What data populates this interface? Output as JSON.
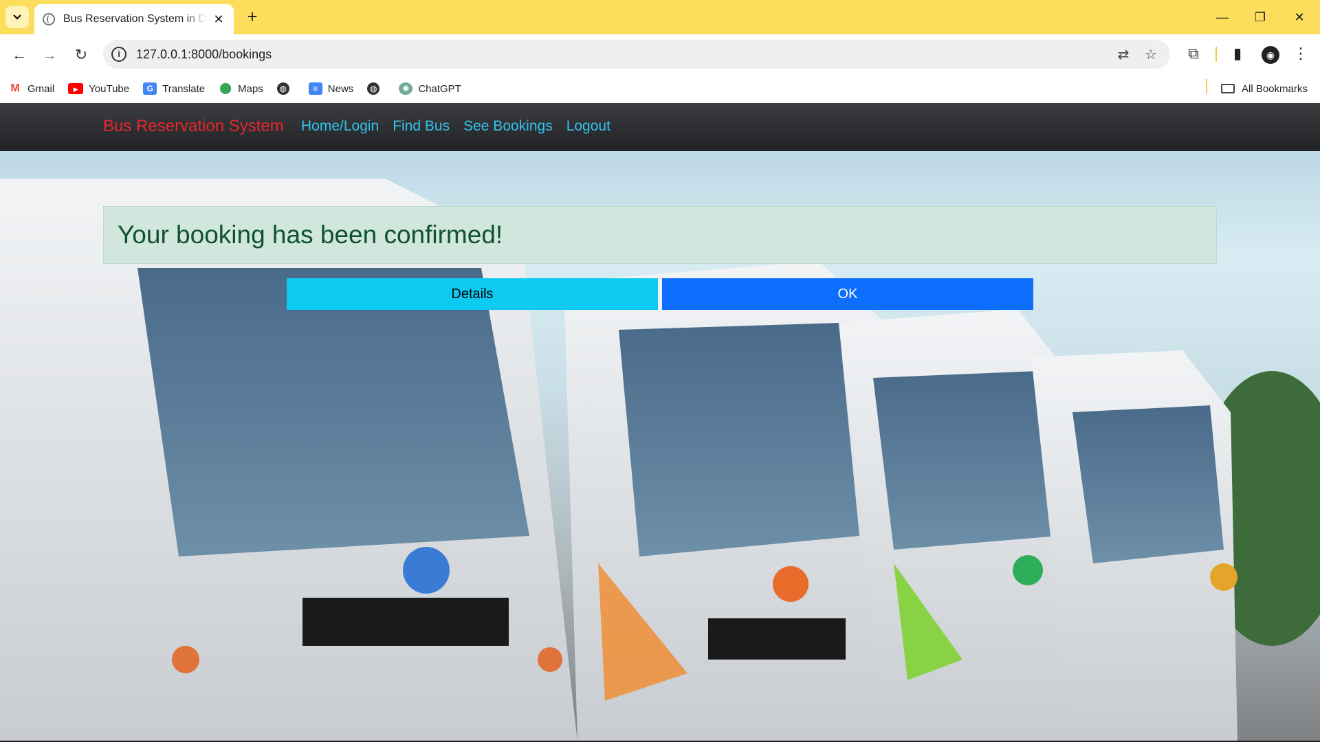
{
  "browser": {
    "tab_title": "Bus Reservation System in Djan",
    "url": "127.0.0.1:8000/bookings",
    "bookmarks": [
      "Gmail",
      "YouTube",
      "Translate",
      "Maps",
      "",
      "News",
      "",
      "ChatGPT"
    ],
    "all_bookmarks": "All Bookmarks"
  },
  "navbar": {
    "brand": "Bus Reservation System",
    "links": [
      "Home/Login",
      "Find Bus",
      "See Bookings",
      "Logout"
    ]
  },
  "alert": {
    "message": "Your booking has been confirmed!"
  },
  "buttons": {
    "details": "Details",
    "ok": "OK"
  },
  "colors": {
    "tabstrip": "#fdde5c",
    "brand": "#e5262c",
    "nav_link": "#31c4ee",
    "alert_bg": "#d1e7dd",
    "alert_text": "#0f5132",
    "details_btn": "#0dcaf0",
    "ok_btn": "#0d6efd"
  }
}
